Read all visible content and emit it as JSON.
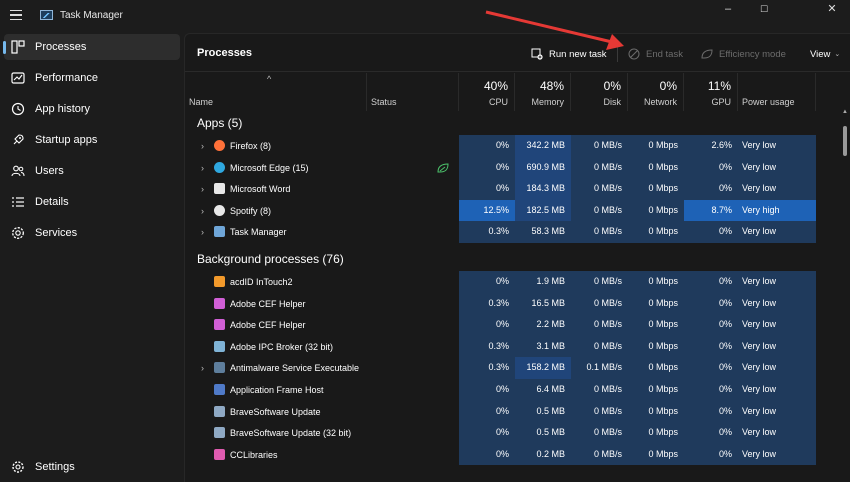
{
  "window": {
    "title": "Task Manager",
    "controls": [
      "–",
      "☐",
      "✕"
    ]
  },
  "sidebar": {
    "items": [
      {
        "label": "Processes",
        "icon": "processes-icon",
        "active": true
      },
      {
        "label": "Performance",
        "icon": "performance-icon"
      },
      {
        "label": "App history",
        "icon": "app-history-icon"
      },
      {
        "label": "Startup apps",
        "icon": "startup-apps-icon"
      },
      {
        "label": "Users",
        "icon": "users-icon"
      },
      {
        "label": "Details",
        "icon": "details-icon"
      },
      {
        "label": "Services",
        "icon": "services-icon"
      }
    ],
    "settings_label": "Settings"
  },
  "toolbar": {
    "page_title": "Processes",
    "run_new_task": "Run new task",
    "end_task": "End task",
    "efficiency_mode": "Efficiency mode",
    "view": "View"
  },
  "columns": {
    "name": "Name",
    "status": "Status",
    "cpu": {
      "pct": "40%",
      "label": "CPU"
    },
    "memory": {
      "pct": "48%",
      "label": "Memory"
    },
    "disk": {
      "pct": "0%",
      "label": "Disk"
    },
    "network": {
      "pct": "0%",
      "label": "Network"
    },
    "gpu": {
      "pct": "11%",
      "label": "GPU"
    },
    "power": {
      "label": "Power usage"
    }
  },
  "groups": {
    "apps": "Apps (5)",
    "background": "Background processes (76)"
  },
  "apps": [
    {
      "name": "Firefox (8)",
      "expand": true,
      "icon": "firefox-icon",
      "cpu": "0%",
      "memory": "342.2 MB",
      "disk": "0 MB/s",
      "network": "0 Mbps",
      "gpu": "2.6%",
      "power": "Very low"
    },
    {
      "name": "Microsoft Edge (15)",
      "expand": true,
      "icon": "edge-icon",
      "status_icon": "efficiency-leaf-icon",
      "cpu": "0%",
      "memory": "690.9 MB",
      "disk": "0 MB/s",
      "network": "0 Mbps",
      "gpu": "0%",
      "power": "Very low"
    },
    {
      "name": "Microsoft Word",
      "expand": true,
      "icon": "word-icon",
      "cpu": "0%",
      "memory": "184.3 MB",
      "disk": "0 MB/s",
      "network": "0 Mbps",
      "gpu": "0%",
      "power": "Very low"
    },
    {
      "name": "Spotify (8)",
      "expand": true,
      "icon": "spotify-icon",
      "cpu": "12.5%",
      "memory": "182.5 MB",
      "disk": "0 MB/s",
      "network": "0 Mbps",
      "gpu": "8.7%",
      "power": "Very high"
    },
    {
      "name": "Task Manager",
      "expand": true,
      "icon": "task-manager-icon",
      "cpu": "0.3%",
      "memory": "58.3 MB",
      "disk": "0 MB/s",
      "network": "0 Mbps",
      "gpu": "0%",
      "power": "Very low"
    }
  ],
  "background": [
    {
      "name": "acdID InTouch2",
      "icon": "acdid-icon",
      "cpu": "0%",
      "memory": "1.9 MB",
      "disk": "0 MB/s",
      "network": "0 Mbps",
      "gpu": "0%",
      "power": "Very low"
    },
    {
      "name": "Adobe CEF Helper",
      "icon": "adobe-cef-icon",
      "cpu": "0.3%",
      "memory": "16.5 MB",
      "disk": "0 MB/s",
      "network": "0 Mbps",
      "gpu": "0%",
      "power": "Very low"
    },
    {
      "name": "Adobe CEF Helper",
      "icon": "adobe-cef-icon",
      "cpu": "0%",
      "memory": "2.2 MB",
      "disk": "0 MB/s",
      "network": "0 Mbps",
      "gpu": "0%",
      "power": "Very low"
    },
    {
      "name": "Adobe IPC Broker (32 bit)",
      "icon": "adobe-ipc-icon",
      "cpu": "0.3%",
      "memory": "3.1 MB",
      "disk": "0 MB/s",
      "network": "0 Mbps",
      "gpu": "0%",
      "power": "Very low"
    },
    {
      "name": "Antimalware Service Executable",
      "expand": true,
      "icon": "antimalware-icon",
      "cpu": "0.3%",
      "memory": "158.2 MB",
      "disk": "0.1 MB/s",
      "network": "0 Mbps",
      "gpu": "0%",
      "power": "Very low"
    },
    {
      "name": "Application Frame Host",
      "icon": "app-frame-icon",
      "cpu": "0%",
      "memory": "6.4 MB",
      "disk": "0 MB/s",
      "network": "0 Mbps",
      "gpu": "0%",
      "power": "Very low"
    },
    {
      "name": "BraveSoftware Update",
      "icon": "brave-update-icon",
      "cpu": "0%",
      "memory": "0.5 MB",
      "disk": "0 MB/s",
      "network": "0 Mbps",
      "gpu": "0%",
      "power": "Very low"
    },
    {
      "name": "BraveSoftware Update (32 bit)",
      "icon": "brave-update-icon",
      "cpu": "0%",
      "memory": "0.5 MB",
      "disk": "0 MB/s",
      "network": "0 Mbps",
      "gpu": "0%",
      "power": "Very low"
    },
    {
      "name": "CCLibraries",
      "icon": "cclibraries-icon",
      "cpu": "0%",
      "memory": "0.2 MB",
      "disk": "0 MB/s",
      "network": "0 Mbps",
      "gpu": "0%",
      "power": "Very low"
    }
  ],
  "colors": {
    "heat_low": "#1f3a5c",
    "heat_mid": "#20457a",
    "heat_high": "#1e62b6",
    "accent": "#76b9ed",
    "annotation_arrow": "#e53935"
  }
}
